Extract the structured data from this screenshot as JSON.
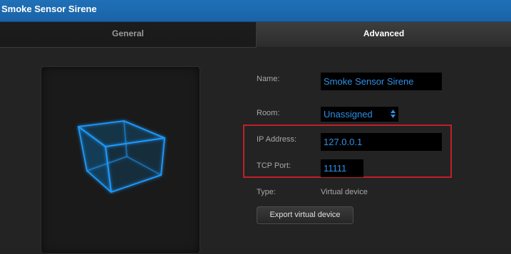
{
  "window": {
    "title": "Smoke Sensor Sirene"
  },
  "tabs": [
    {
      "label": "General",
      "active": false
    },
    {
      "label": "Advanced",
      "active": true
    }
  ],
  "preview": {
    "icon": "cube-icon"
  },
  "form": {
    "name_label": "Name:",
    "name_value": "Smoke Sensor Sirene",
    "room_label": "Room:",
    "room_value": "Unassigned",
    "ip_label": "IP Address:",
    "ip_value": "127.0.0.1",
    "port_label": "TCP Port:",
    "port_value": "11111",
    "type_label": "Type:",
    "type_value": "Virtual device"
  },
  "actions": {
    "export_label": "Export virtual device"
  },
  "colors": {
    "titlebar": "#1a66ab",
    "field_text": "#2f8fe6",
    "highlight": "#c0202a",
    "cube": "#1e9bff"
  }
}
